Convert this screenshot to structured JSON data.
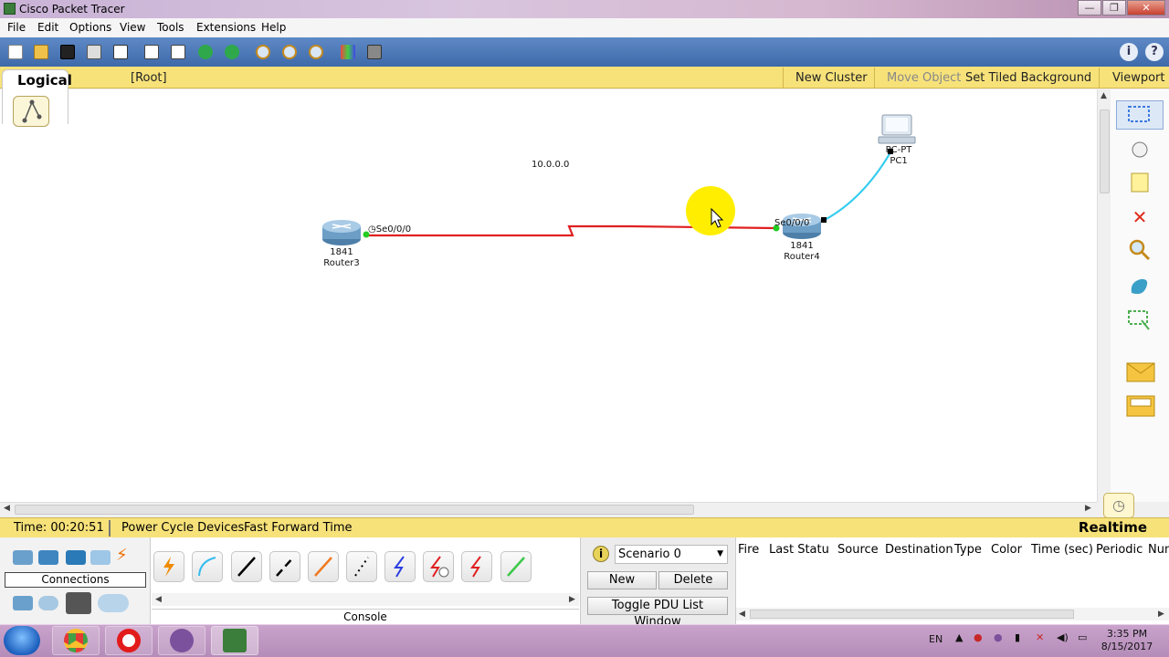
{
  "window": {
    "title": "Cisco Packet Tracer",
    "buttons": [
      "—",
      "❐",
      "✕"
    ]
  },
  "menu": [
    "File",
    "Edit",
    "Options",
    "View",
    "Tools",
    "Extensions",
    "Help"
  ],
  "toolbar": {
    "icons": [
      "new-file-icon",
      "open-folder-icon",
      "save-icon",
      "print-icon",
      "activity-wizard-icon",
      "copy-icon",
      "paste-icon",
      "undo-icon",
      "redo-icon",
      "zoom-in-icon",
      "zoom-reset-icon",
      "zoom-out-icon",
      "palette-icon",
      "custom-device-icon"
    ],
    "help_info": "i",
    "help_question": "?"
  },
  "logical_bar": {
    "tab_label": "Logical",
    "root": "[Root]",
    "new_cluster": "New Cluster",
    "move_object": "Move Object",
    "set_tiled_background": "Set Tiled Background",
    "viewport": "Viewport"
  },
  "topology": {
    "network_label": "10.0.0.0",
    "router3": {
      "model": "1841",
      "name": "Router3",
      "interface": "Se0/0/0"
    },
    "router4": {
      "model": "1841",
      "name": "Router4",
      "interface": "Se0/0/0"
    },
    "pc1": {
      "model": "PC-PT",
      "name": "PC1"
    },
    "link_colors": {
      "serial": "#e02020",
      "console": "#33ccee",
      "up": "#22cc22",
      "down": "#000000"
    },
    "cursor_highlight": "#ffee00"
  },
  "right_tools": [
    "select-icon",
    "hand-icon",
    "note-icon",
    "delete-icon",
    "inspect-icon",
    "draw-shape-icon",
    "resize-icon",
    "add-simple-pdu-icon",
    "add-complex-pdu-icon"
  ],
  "status": {
    "time_label": "Time: 00:20:51",
    "power_cycle": "Power Cycle Devices",
    "fast_forward": "Fast Forward Time",
    "mode": "Realtime"
  },
  "device_panel": {
    "category_label": "Connections"
  },
  "cables": [
    "automatic-connection-icon",
    "console-cable-icon",
    "copper-straight-icon",
    "copper-cross-icon",
    "fiber-icon",
    "phone-cable-icon",
    "coaxial-cable-icon",
    "serial-dce-icon",
    "serial-dte-icon",
    "octal-cable-icon"
  ],
  "console_label": "Console",
  "scenario": {
    "info": "i",
    "selected": "Scenario 0",
    "new_button": "New",
    "delete_button": "Delete",
    "toggle_button": "Toggle PDU List Window"
  },
  "pdu_columns": [
    "Fire",
    "Last Statu",
    "Source",
    "Destination",
    "Type",
    "Color",
    "Time (sec)",
    "Periodic",
    "Num"
  ],
  "taskbar": {
    "apps": [
      "chrome-icon",
      "opera-icon",
      "viber-icon",
      "packet-tracer-icon"
    ],
    "lang": "EN",
    "time": "3:35 PM",
    "date": "8/15/2017"
  }
}
